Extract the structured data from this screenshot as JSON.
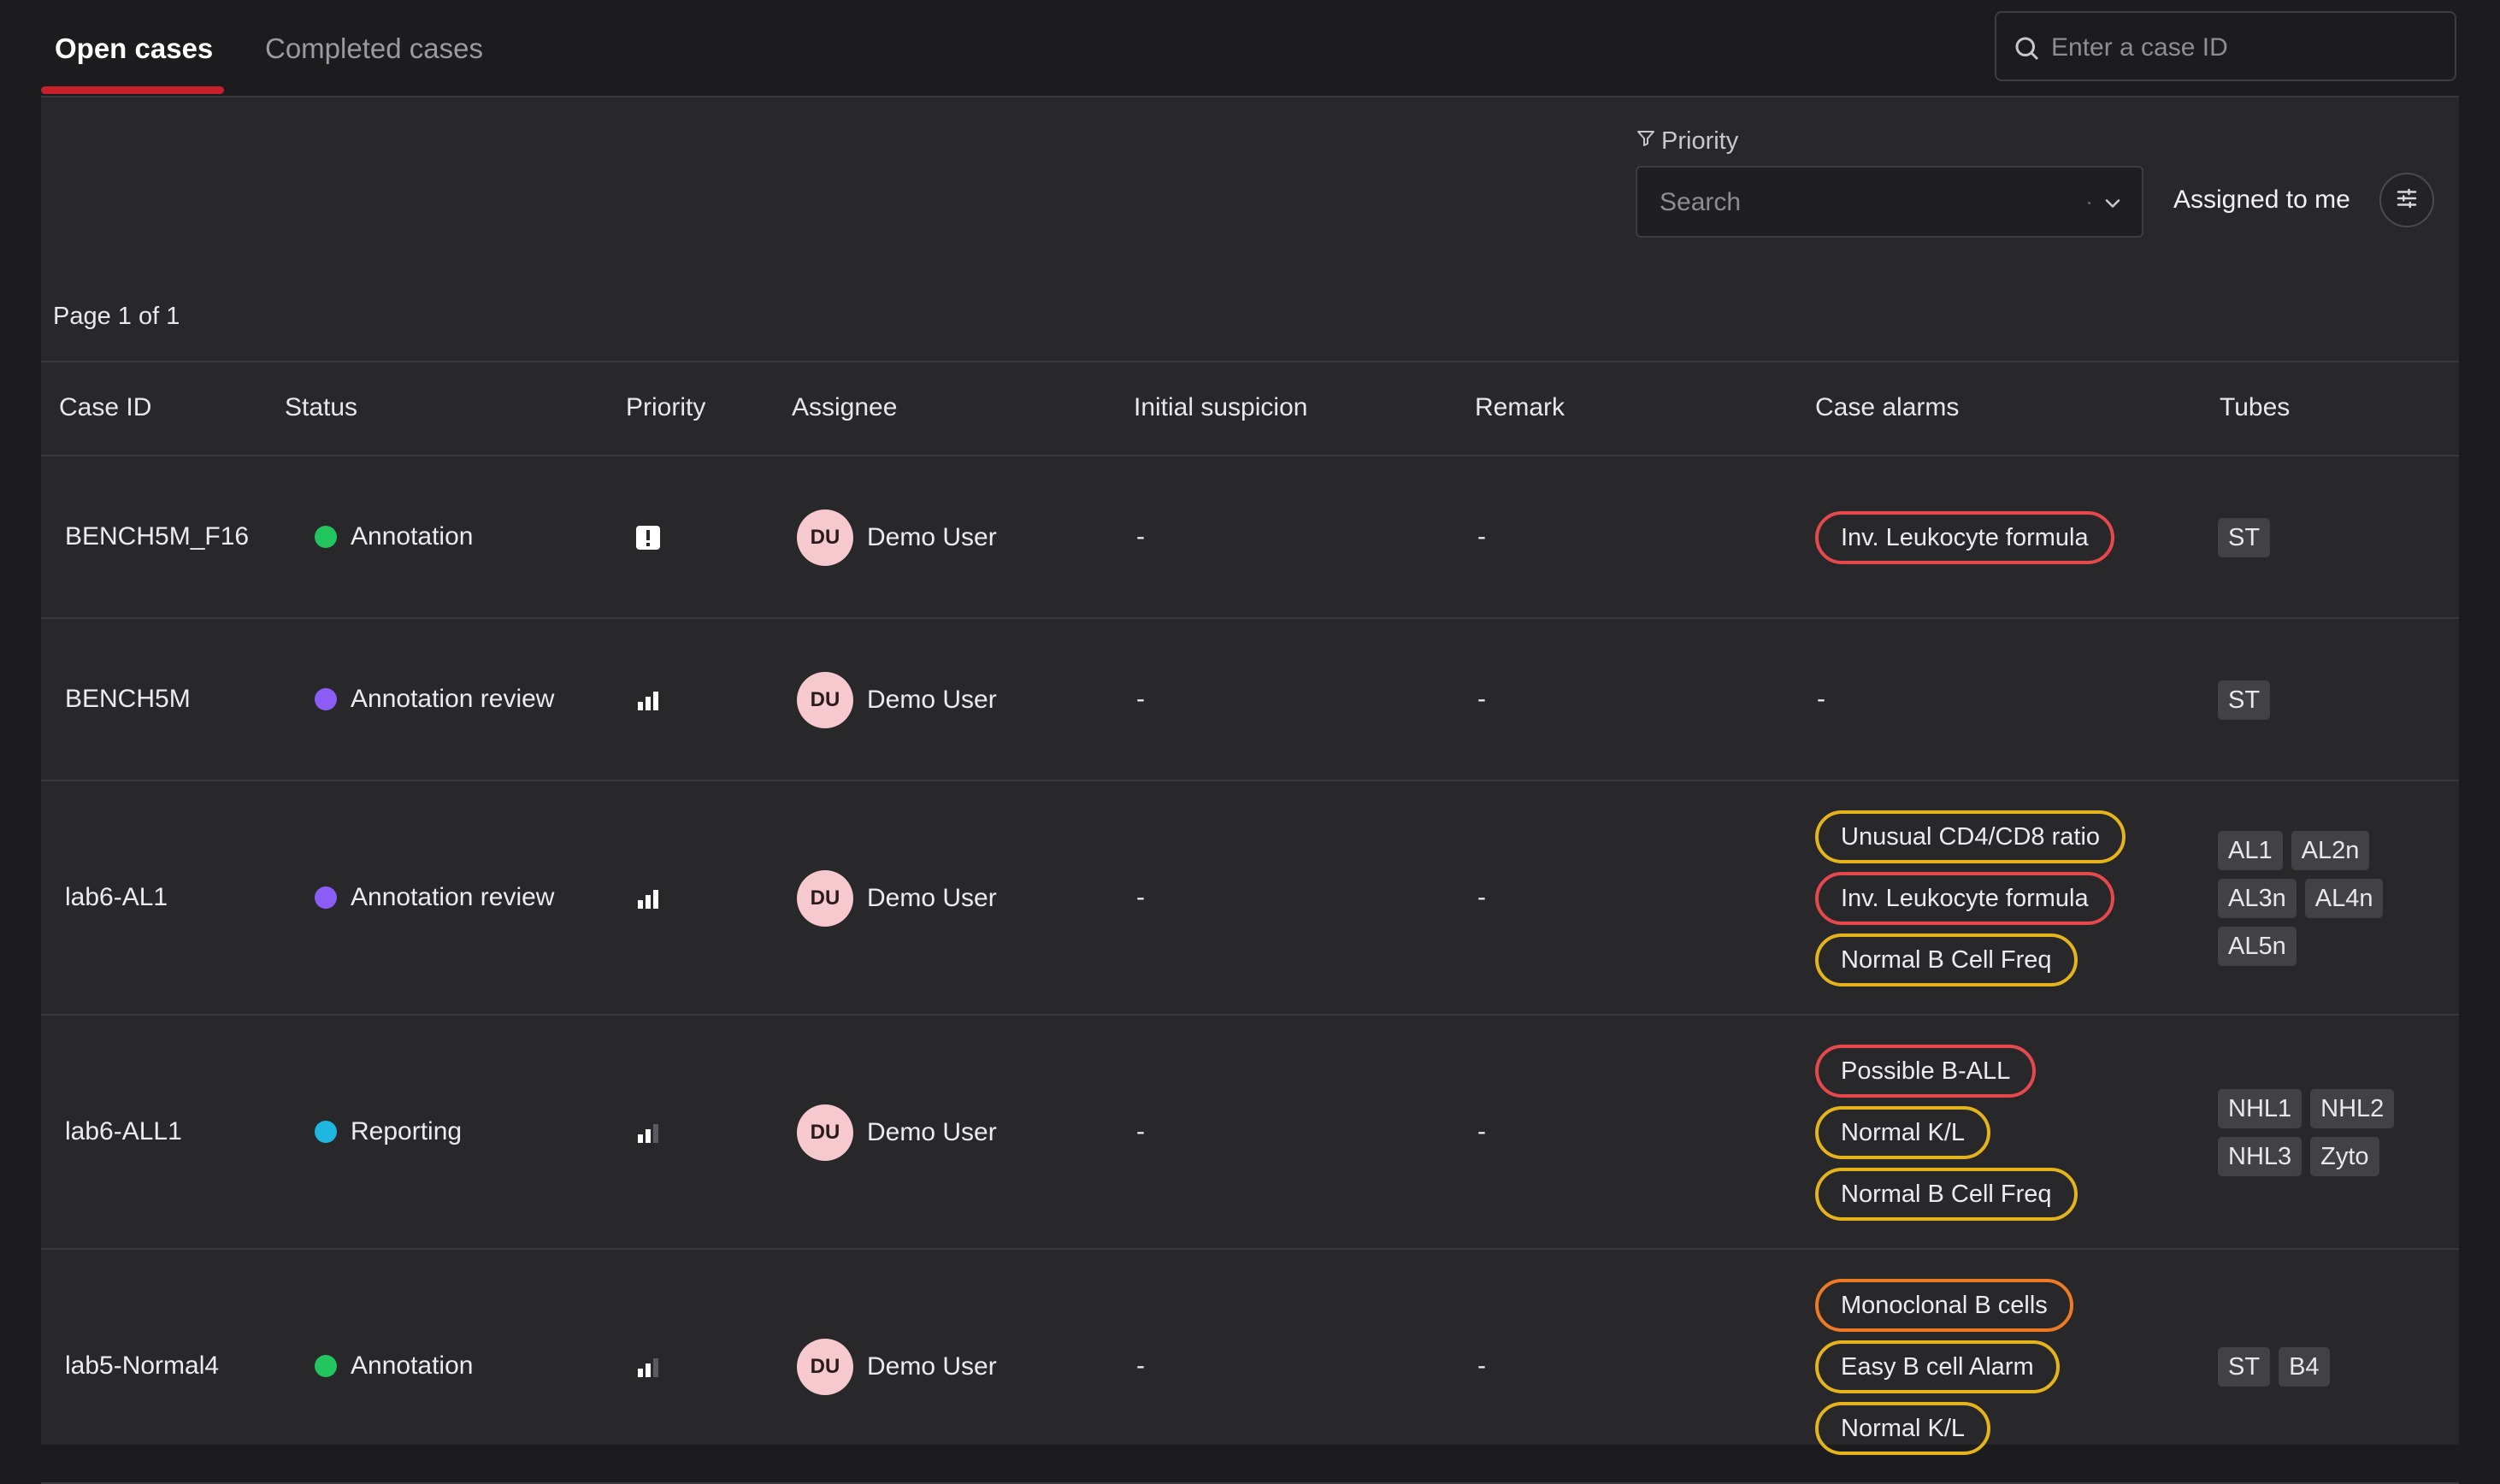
{
  "tabs": [
    {
      "label": "Open cases",
      "active": true
    },
    {
      "label": "Completed cases",
      "active": false
    }
  ],
  "search": {
    "placeholder": "Enter a case ID"
  },
  "filter": {
    "label": "Priority",
    "placeholder": "Search"
  },
  "assigned_toggle": {
    "label": "Assigned to me"
  },
  "page_info": "Page 1 of 1",
  "colors": {
    "accent": "#c8202a",
    "status_annotation": "#22c55e",
    "status_review": "#8b5cf6",
    "status_reporting": "#1fb6e0",
    "alarm_red": "#e5484d",
    "alarm_yellow": "#e5b31c",
    "alarm_orange": "#ef7a23"
  },
  "table": {
    "headers": [
      "Case ID",
      "Status",
      "Priority",
      "Assignee",
      "Initial suspicion",
      "Remark",
      "Case alarms",
      "Tubes"
    ],
    "rows": [
      {
        "case_id": "BENCH5M_F16",
        "status": "Annotation",
        "status_color": "#22c55e",
        "priority_icon": "urgent-exclamation-icon",
        "assignee_initials": "DU",
        "assignee": "Demo User",
        "initial_suspicion": "-",
        "remark": "-",
        "alarms": [
          {
            "label": "Inv. Leukocyte formula",
            "color": "#e5484d"
          }
        ],
        "alarms_text": "",
        "tubes": [
          "ST"
        ]
      },
      {
        "case_id": "BENCH5M",
        "status": "Annotation review",
        "status_color": "#8b5cf6",
        "priority_icon": "priority-high-bars-icon",
        "assignee_initials": "DU",
        "assignee": "Demo User",
        "initial_suspicion": "-",
        "remark": "-",
        "alarms": [],
        "alarms_text": "-",
        "tubes": [
          "ST"
        ]
      },
      {
        "case_id": "lab6-AL1",
        "status": "Annotation review",
        "status_color": "#8b5cf6",
        "priority_icon": "priority-high-bars-icon",
        "assignee_initials": "DU",
        "assignee": "Demo User",
        "initial_suspicion": "-",
        "remark": "-",
        "alarms": [
          {
            "label": "Unusual CD4/CD8 ratio",
            "color": "#e5b31c"
          },
          {
            "label": "Inv. Leukocyte formula",
            "color": "#e5484d"
          },
          {
            "label": "Normal B Cell Freq",
            "color": "#e5b31c"
          }
        ],
        "alarms_text": "",
        "tubes": [
          "AL1",
          "AL2n",
          "AL3n",
          "AL4n",
          "AL5n"
        ]
      },
      {
        "case_id": "lab6-ALL1",
        "status": "Reporting",
        "status_color": "#1fb6e0",
        "priority_icon": "priority-medium-bars-icon",
        "assignee_initials": "DU",
        "assignee": "Demo User",
        "initial_suspicion": "-",
        "remark": "-",
        "alarms": [
          {
            "label": "Possible B-ALL",
            "color": "#e5484d"
          },
          {
            "label": "Normal K/L",
            "color": "#e5b31c"
          },
          {
            "label": "Normal B Cell Freq",
            "color": "#e5b31c"
          }
        ],
        "alarms_text": "",
        "tubes": [
          "NHL1",
          "NHL2",
          "NHL3",
          "Zyto"
        ]
      },
      {
        "case_id": "lab5-Normal4",
        "status": "Annotation",
        "status_color": "#22c55e",
        "priority_icon": "priority-medium-bars-icon",
        "assignee_initials": "DU",
        "assignee": "Demo User",
        "initial_suspicion": "-",
        "remark": "-",
        "alarms": [
          {
            "label": "Monoclonal B cells",
            "color": "#ef7a23"
          },
          {
            "label": "Easy B cell Alarm",
            "color": "#e5b31c"
          },
          {
            "label": "Normal K/L",
            "color": "#e5b31c"
          }
        ],
        "alarms_text": "",
        "tubes": [
          "ST",
          "B4"
        ]
      }
    ]
  }
}
